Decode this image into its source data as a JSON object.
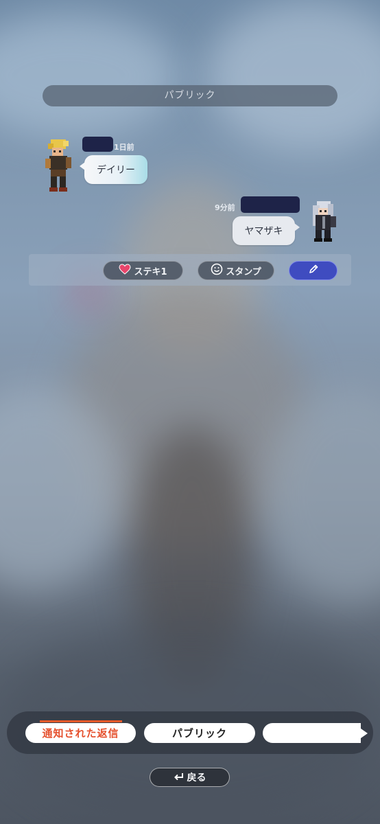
{
  "header": {
    "title": "パブリック"
  },
  "posts": [
    {
      "timestamp": "1日前",
      "message": "デイリー",
      "side": "left",
      "avatar": "blonde-pixel-character-icon"
    },
    {
      "timestamp": "9分前",
      "message": "ヤマザキ",
      "side": "right",
      "avatar": "silver-hair-pixel-character-icon"
    }
  ],
  "actions": {
    "like_label": "ステキ1",
    "stamp_label": "スタンプ",
    "edit_icon": "pencil-icon",
    "accent": "#3f4cc0"
  },
  "tabs": [
    {
      "label": "通知された返信",
      "active": true,
      "color": "#e5502d"
    },
    {
      "label": "パブリック",
      "active": false
    },
    {
      "label": "",
      "active": false
    }
  ],
  "footer": {
    "back_label": "戻る"
  }
}
